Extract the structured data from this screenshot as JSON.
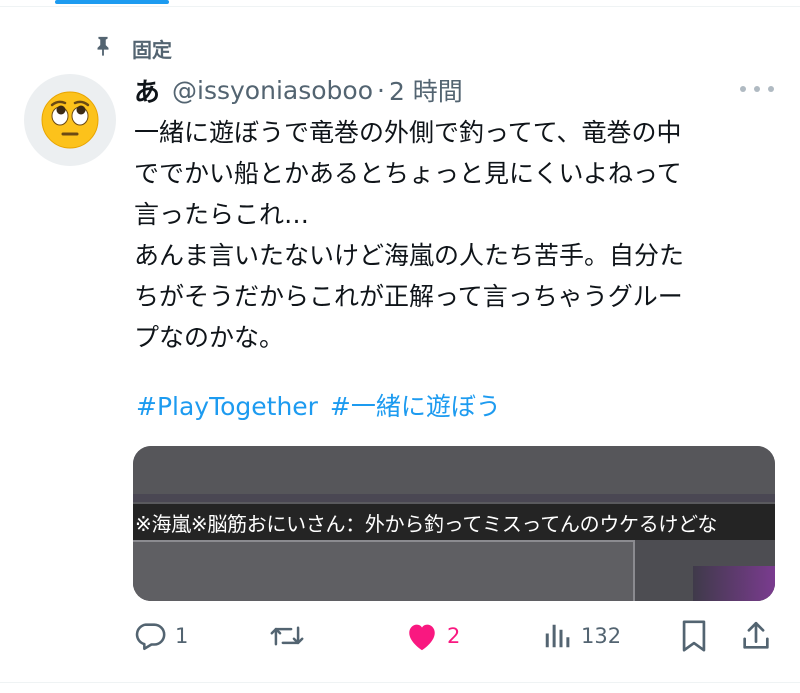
{
  "pinned_label": "固定",
  "tweet": {
    "display_name": "あ",
    "handle": "@issyoniasoboo",
    "separator": "·",
    "time": "2 時間",
    "text": "一緒に遊ぼうで竜巻の外側で釣ってて、竜巻の中\nででかい船とかあるとちょっと見にくいよねって\n言ったらこれ…\nあんま言いたないけど海嵐の人たち苦手。自分た\nちがそうだからこれが正解って言っちゃうグルー\nプなのかな。",
    "hashtags": [
      "#PlayTogether",
      "#一緒に遊ぼう"
    ],
    "media_caption": "※海嵐※脳筋おにいさん：外から釣ってミスってんのウケるけどな"
  },
  "actions": {
    "replies": "1",
    "retweets": "",
    "likes": "2",
    "views": "132"
  },
  "colors": {
    "accent": "#1d9bf0",
    "like": "#f91880",
    "muted": "#536471"
  },
  "icons": [
    "pin-icon",
    "avatar-emoji",
    "more-icon",
    "reply-icon",
    "retweet-icon",
    "like-icon",
    "views-icon",
    "bookmark-icon",
    "share-icon"
  ]
}
